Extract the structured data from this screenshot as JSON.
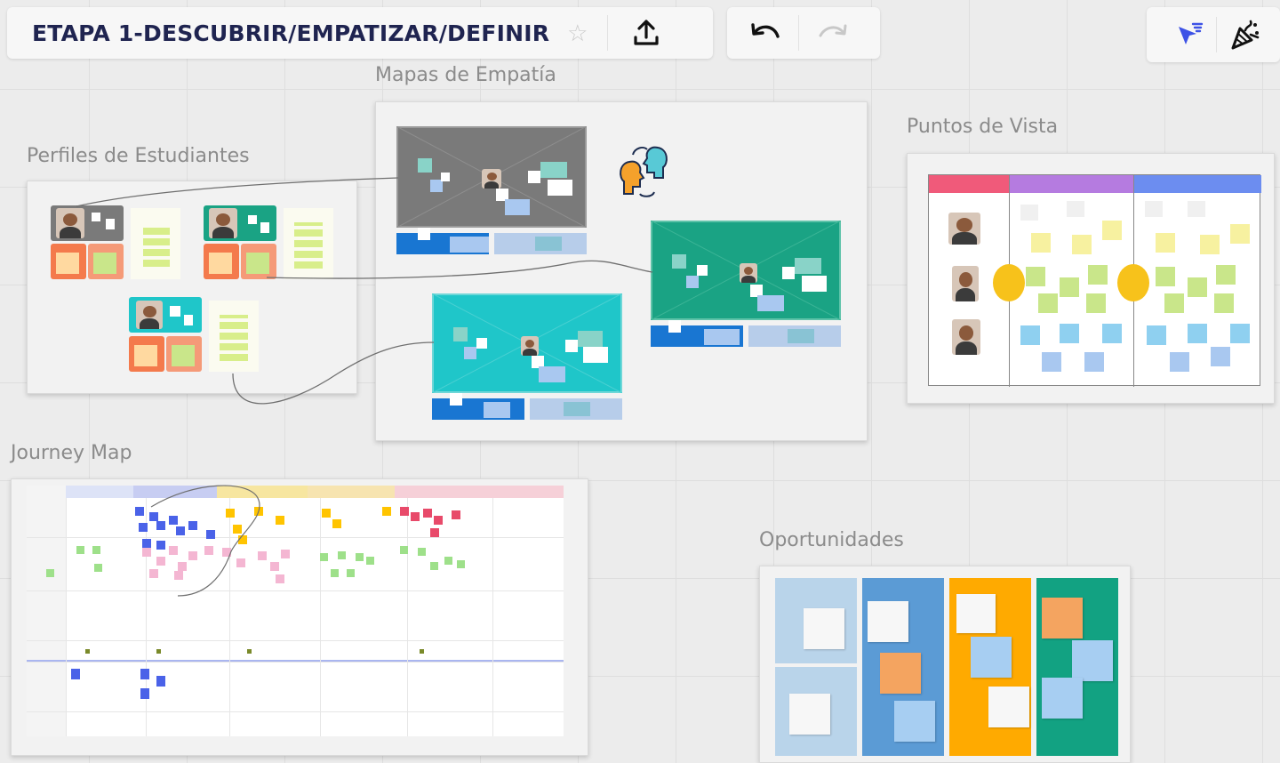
{
  "board": {
    "title": "ETAPA 1-DESCUBRIR/EMPATIZAR/DEFINIR",
    "star_icon": "star-icon",
    "share_icon": "upload-icon",
    "undo_icon": "undo-icon",
    "redo_icon": "redo-icon",
    "cursor_icon": "pointer-icon",
    "celebrate_icon": "party-popper-icon"
  },
  "frames": {
    "perfiles": "Perfiles de Estudiantes",
    "mapas": "Mapas de Empatía",
    "puntos": "Puntos de Vista",
    "journey": "Journey Map",
    "oportunidades": "Oportunidades"
  },
  "colors": {
    "accent": "#4262ff",
    "title": "#1f2450",
    "teal": "#1aa384",
    "cyan": "#1fc6c9",
    "gray_map": "#7a7a7a",
    "orange": "#f47a4c",
    "yellow_sticky": "#fbf5a0",
    "green_sticky": "#c9e68a",
    "blue_sticky": "#8fd0f0",
    "opp_blue": "#5b9bd5",
    "opp_orange": "#ffaa00",
    "opp_teal": "#12a282"
  }
}
